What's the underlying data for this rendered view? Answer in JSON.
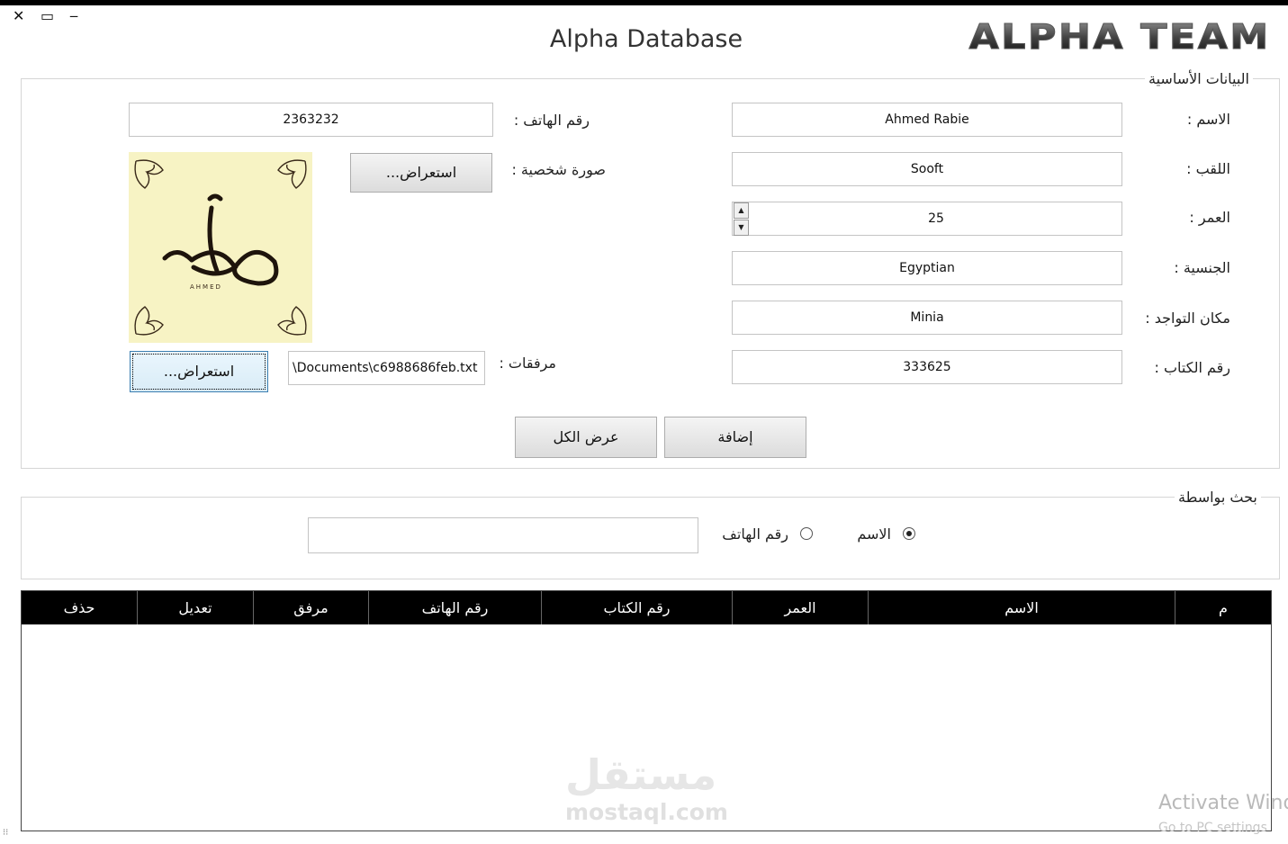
{
  "window": {
    "title": "Alpha Database",
    "close_glyph": "✕",
    "maximize_glyph": "▭",
    "minimize_glyph": "‒",
    "logo_text": "ALPHA TEAM"
  },
  "basic_group": {
    "legend": "البيانات الأساسية",
    "fields": {
      "name_label": "الاسم :",
      "name_value": "Ahmed Rabie",
      "title_label": "اللقب :",
      "title_value": "Sooft",
      "age_label": "العمر :",
      "age_value": "25",
      "nationality_label": "الجنسية :",
      "nationality_value": "Egyptian",
      "location_label": "مكان التواجد :",
      "location_value": "Minia",
      "book_no_label": "رقم الكتاب :",
      "book_no_value": "333625",
      "phone_label": "رقم الهاتف :",
      "phone_value": "2363232",
      "photo_label": "صورة شخصية :",
      "photo_browse": "استعراض...",
      "photo_caption": "AHMED",
      "attach_label": "مرفقات :",
      "attach_value": "\\Documents\\c6988686feb.txt",
      "attach_browse": "استعراض..."
    },
    "add_button": "إضافة",
    "show_all_button": "عرض الكل"
  },
  "search_group": {
    "legend": "بحث بواسطة",
    "option_name": "الاسم",
    "option_phone": "رقم الهاتف",
    "selected": "الاسم",
    "query": ""
  },
  "table": {
    "columns": [
      "م",
      "الاسم",
      "العمر",
      "رقم الكتاب",
      "رقم الهاتف",
      "مرفق",
      "تعديل",
      "حذف"
    ],
    "rows": []
  },
  "watermark": {
    "logo": "مستقل",
    "url": "mostaql.com"
  },
  "activation": {
    "line1": "Activate Wind",
    "line2": "Go to PC settings"
  },
  "colors": {
    "header_bg": "#000000",
    "photo_bg": "#f7f3c4",
    "accent": "#3c7fb1"
  }
}
